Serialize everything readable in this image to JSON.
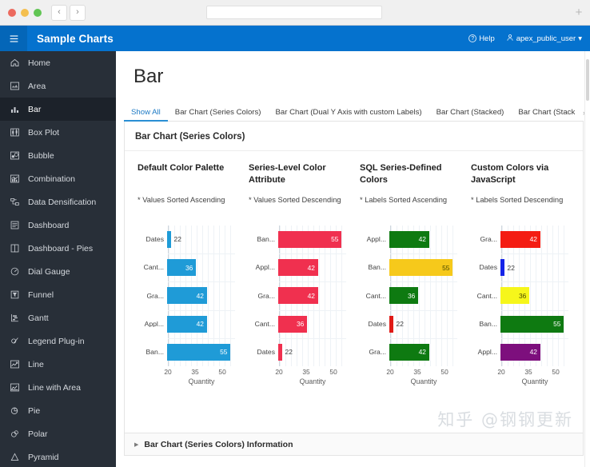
{
  "browser": {
    "back_label": "‹",
    "forward_label": "›",
    "url_value": "",
    "url_placeholder": "",
    "newtab_label": "+"
  },
  "header": {
    "menu_icon": "hamburger-icon",
    "title": "Sample Charts",
    "help_label": "Help",
    "user_label": "apex_public_user",
    "user_caret": "▾"
  },
  "sidebar": {
    "items": [
      {
        "label": "Home",
        "icon": "home-icon",
        "active": false
      },
      {
        "label": "Area",
        "icon": "area-chart-icon",
        "active": false
      },
      {
        "label": "Bar",
        "icon": "bar-chart-icon",
        "active": true
      },
      {
        "label": "Box Plot",
        "icon": "box-plot-icon",
        "active": false
      },
      {
        "label": "Bubble",
        "icon": "bubble-chart-icon",
        "active": false
      },
      {
        "label": "Combination",
        "icon": "combination-chart-icon",
        "active": false
      },
      {
        "label": "Data Densification",
        "icon": "data-densification-icon",
        "active": false
      },
      {
        "label": "Dashboard",
        "icon": "dashboard-icon",
        "active": false
      },
      {
        "label": "Dashboard - Pies",
        "icon": "dashboard-pies-icon",
        "active": false
      },
      {
        "label": "Dial Gauge",
        "icon": "dial-gauge-icon",
        "active": false
      },
      {
        "label": "Funnel",
        "icon": "funnel-icon",
        "active": false
      },
      {
        "label": "Gantt",
        "icon": "gantt-icon",
        "active": false
      },
      {
        "label": "Legend Plug-in",
        "icon": "legend-plugin-icon",
        "active": false
      },
      {
        "label": "Line",
        "icon": "line-chart-icon",
        "active": false
      },
      {
        "label": "Line with Area",
        "icon": "line-area-icon",
        "active": false
      },
      {
        "label": "Pie",
        "icon": "pie-chart-icon",
        "active": false
      },
      {
        "label": "Polar",
        "icon": "polar-chart-icon",
        "active": false
      },
      {
        "label": "Pyramid",
        "icon": "pyramid-icon",
        "active": false
      }
    ]
  },
  "main": {
    "page_title": "Bar",
    "tabs": [
      {
        "label": "Show All",
        "active": true
      },
      {
        "label": "Bar Chart (Series Colors)",
        "active": false
      },
      {
        "label": "Bar Chart (Dual Y Axis with custom Labels)",
        "active": false
      },
      {
        "label": "Bar Chart (Stacked)",
        "active": false
      },
      {
        "label": "Bar Chart (Stack",
        "active": false
      }
    ],
    "tab_scroll_icon": "chevron-right-icon",
    "panel_title": "Bar Chart (Series Colors)",
    "info_label": "Bar Chart (Series Colors) Information",
    "info_caret": "▶",
    "watermark": "知乎 @钢钢更新"
  },
  "chart_data": [
    {
      "type": "bar",
      "orientation": "horizontal",
      "title": "Default Color Palette",
      "subtitle": "* Values Sorted Ascending",
      "xlabel": "Quantity",
      "ylabel": "",
      "xticks": [
        20,
        35,
        50
      ],
      "xlim": [
        20,
        57
      ],
      "grid": true,
      "categories": [
        "Dates",
        "Cant...",
        "Gra...",
        "Appl...",
        "Ban..."
      ],
      "values": [
        22,
        36,
        42,
        42,
        55
      ],
      "colors": [
        "#1f9bd7",
        "#1f9bd7",
        "#1f9bd7",
        "#1f9bd7",
        "#1f9bd7"
      ],
      "label_inside": [
        false,
        true,
        true,
        true,
        true
      ]
    },
    {
      "type": "bar",
      "orientation": "horizontal",
      "title": "Series-Level Color Attribute",
      "subtitle": "* Values Sorted Descending",
      "xlabel": "Quantity",
      "ylabel": "",
      "xticks": [
        20,
        35,
        50
      ],
      "xlim": [
        20,
        57
      ],
      "grid": true,
      "categories": [
        "Ban...",
        "Appl...",
        "Gra...",
        "Cant...",
        "Dates"
      ],
      "values": [
        55,
        42,
        42,
        36,
        22
      ],
      "colors": [
        "#f0304f",
        "#f0304f",
        "#f0304f",
        "#f0304f",
        "#f0304f"
      ],
      "label_inside": [
        true,
        true,
        true,
        true,
        false
      ]
    },
    {
      "type": "bar",
      "orientation": "horizontal",
      "title": "SQL Series-Defined Colors",
      "subtitle": "* Labels Sorted Ascending",
      "xlabel": "Quantity",
      "ylabel": "",
      "xticks": [
        20,
        35,
        50
      ],
      "xlim": [
        20,
        57
      ],
      "grid": true,
      "categories": [
        "Appl...",
        "Ban...",
        "Cant...",
        "Dates",
        "Gra..."
      ],
      "values": [
        42,
        55,
        36,
        22,
        42
      ],
      "colors": [
        "#0e7a11",
        "#f6c91b",
        "#0e7a11",
        "#e01a16",
        "#0e7a11"
      ],
      "label_inside": [
        true,
        true,
        true,
        false,
        true
      ]
    },
    {
      "type": "bar",
      "orientation": "horizontal",
      "title": "Custom Colors via JavaScript",
      "subtitle": "* Labels Sorted Descending",
      "xlabel": "Quantity",
      "ylabel": "",
      "xticks": [
        20,
        35,
        50
      ],
      "xlim": [
        20,
        57
      ],
      "grid": true,
      "categories": [
        "Gra...",
        "Dates",
        "Cant...",
        "Ban...",
        "Appl..."
      ],
      "values": [
        42,
        22,
        36,
        55,
        42
      ],
      "colors": [
        "#f41d13",
        "#1524e8",
        "#f6f61b",
        "#0e7a11",
        "#7d0f7d"
      ],
      "label_inside": [
        true,
        false,
        true,
        true,
        true
      ]
    }
  ],
  "colors": {
    "header_blue": "#0572ce",
    "sidebar_dark": "#282f38",
    "sidebar_active": "#1c222a",
    "accent_link": "#1b79c4"
  }
}
